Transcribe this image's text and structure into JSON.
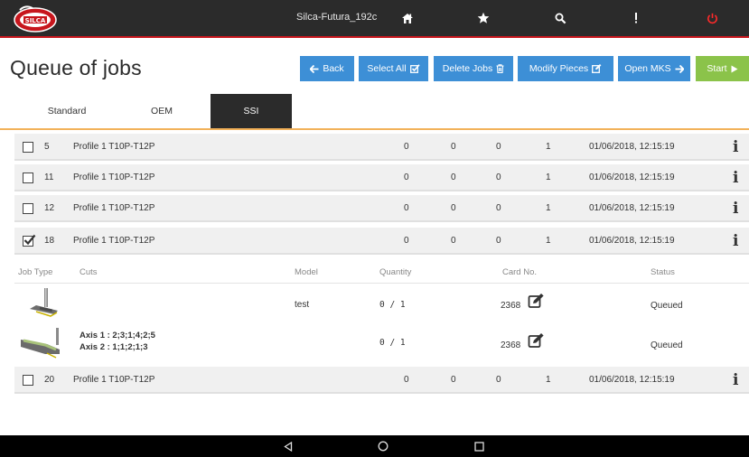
{
  "header": {
    "device_name": "Silca-Futura_192c",
    "icons": [
      "home-icon",
      "star-icon",
      "search-icon",
      "more-icon",
      "power-icon"
    ]
  },
  "page": {
    "title": "Queue of jobs"
  },
  "toolbar": {
    "back": "Back",
    "select_all": "Select All",
    "delete_jobs": "Delete Jobs",
    "modify_pieces": "Modify Pieces",
    "open_mks": "Open MKS",
    "start": "Start"
  },
  "tabs": [
    {
      "label": "Standard",
      "active": false
    },
    {
      "label": "OEM",
      "active": false
    },
    {
      "label": "SSI",
      "active": true
    }
  ],
  "jobs": [
    {
      "id": "5",
      "profile": "Profile 1 T10P-T12P",
      "c1": "0",
      "c2": "0",
      "c3": "0",
      "c4": "1",
      "date": "01/06/2018, 12:15:19",
      "checked": false
    },
    {
      "id": "11",
      "profile": "Profile 1 T10P-T12P",
      "c1": "0",
      "c2": "0",
      "c3": "0",
      "c4": "1",
      "date": "01/06/2018, 12:15:19",
      "checked": false
    },
    {
      "id": "12",
      "profile": "Profile 1 T10P-T12P",
      "c1": "0",
      "c2": "0",
      "c3": "0",
      "c4": "1",
      "date": "01/06/2018, 12:15:19",
      "checked": false
    },
    {
      "id": "18",
      "profile": "Profile 1 T10P-T12P",
      "c1": "0",
      "c2": "0",
      "c3": "0",
      "c4": "1",
      "date": "01/06/2018, 12:15:19",
      "checked": true
    },
    {
      "id": "20",
      "profile": "Profile 1 T10P-T12P",
      "c1": "0",
      "c2": "0",
      "c3": "0",
      "c4": "1",
      "date": "01/06/2018, 12:15:19",
      "checked": false
    }
  ],
  "detail": {
    "headers": {
      "job_type": "Job Type",
      "cuts": "Cuts",
      "model": "Model",
      "quantity": "Quantity",
      "card_no": "Card No.",
      "status": "Status"
    },
    "rows": [
      {
        "cuts_line1": "",
        "cuts_line2": "",
        "model": "test",
        "quantity": "0 / 1",
        "card_no": "2368",
        "status": "Queued"
      },
      {
        "cuts_line1": "Axis 1 : 2;3;1;4;2;5",
        "cuts_line2": "Axis 2 : 1;1;2;1;3",
        "model": "",
        "quantity": "0 / 1",
        "card_no": "2368",
        "status": "Queued"
      }
    ]
  },
  "colors": {
    "primary_button": "#3d8fd6",
    "start_button": "#8bc34a",
    "header_bg": "#2b2b2b",
    "accent_red": "#c7161d",
    "tab_underline": "#f2b25a"
  }
}
